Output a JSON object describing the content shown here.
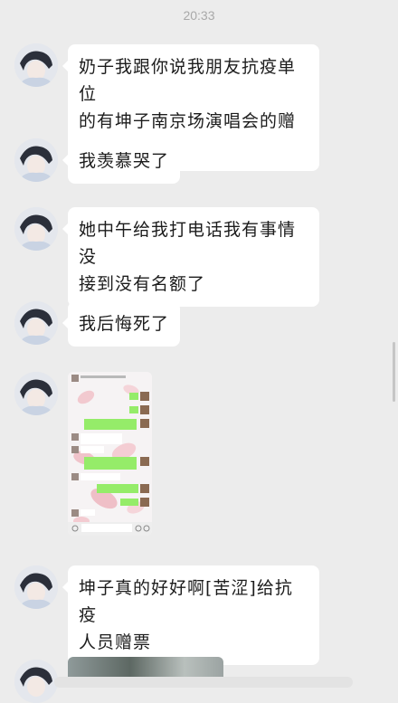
{
  "timestamp": "20:33",
  "messages": [
    {
      "lines": [
        "奶子我跟你说我朋友抗疫单位",
        "的有坤子南京场演唱会的赠票"
      ]
    },
    {
      "lines": [
        "我羡慕哭了"
      ]
    },
    {
      "lines": [
        "她中午给我打电话我有事情没",
        "接到没有名额了"
      ]
    },
    {
      "lines": [
        "我后悔死了"
      ]
    },
    {
      "lines": [
        "坤子真的好好啊[苦涩]给抗疫",
        "人员赠票"
      ]
    }
  ],
  "colors": {
    "background": "#ececec",
    "bubble": "#ffffff",
    "timestamp": "#a9a9a9",
    "screenshot_green": "#95ec69"
  }
}
